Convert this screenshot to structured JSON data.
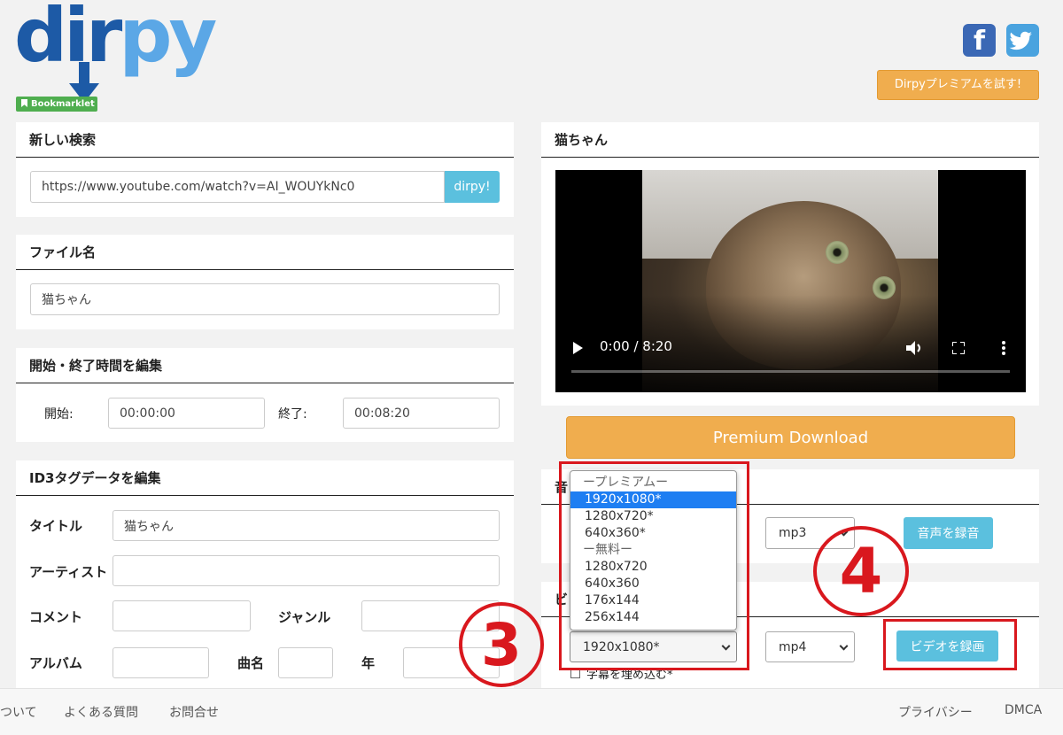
{
  "brand": {
    "logo_main": "dir",
    "logo_accent": "py",
    "bookmarklet": "Bookmarklet"
  },
  "social": {
    "facebook": "f",
    "twitter": "t"
  },
  "premium_try_label": "Dirpyプレミアムを試す!",
  "search": {
    "title": "新しい検索",
    "url": "https://www.youtube.com/watch?v=AI_WOUYkNc0",
    "button": "dirpy!"
  },
  "filename": {
    "title": "ファイル名",
    "value": "猫ちゃん"
  },
  "time_edit": {
    "title": "開始・終了時間を編集",
    "start_label": "開始:",
    "start_value": "00:00:00",
    "end_label": "終了:",
    "end_value": "00:08:20"
  },
  "id3": {
    "title": "ID3タグデータを編集",
    "title_label": "タイトル",
    "title_value": "猫ちゃん",
    "artist_label": "アーティスト",
    "comment_label": "コメント",
    "genre_label": "ジャンル",
    "album_label": "アルバム",
    "track_label": "曲名",
    "year_label": "年"
  },
  "video_panel": {
    "title": "猫ちゃん",
    "time": "0:00 / 8:20"
  },
  "premium_download": "Premium Download",
  "audio": {
    "title_partial": "音",
    "format": "mp3",
    "button": "音声を録音"
  },
  "video_rec": {
    "title_partial": "ビ",
    "quality": "1920x1080*",
    "format": "mp4",
    "button": "ビデオを録画",
    "subtitle_checkbox": "字幕を埋め込む*"
  },
  "quality_dropdown": {
    "premium_header": "ープレミアムー",
    "premium_options": [
      "1920x1080*",
      "1280x720*",
      "640x360*"
    ],
    "free_header": "ー無料ー",
    "free_options": [
      "1280x720",
      "640x360",
      "176x144",
      "256x144"
    ],
    "selected": "1920x1080*"
  },
  "annotations": {
    "step3": "3",
    "step4": "4"
  },
  "footer": {
    "about": "ついて",
    "faq": "よくある質問",
    "contact": "お問合せ",
    "privacy": "プライバシー",
    "dmca": "DMCA"
  },
  "colors": {
    "accent_orange": "#f0ad4e",
    "accent_blue": "#5bc0de",
    "annotation_red": "#d9181e",
    "dropdown_selected": "#1e7ef2"
  }
}
